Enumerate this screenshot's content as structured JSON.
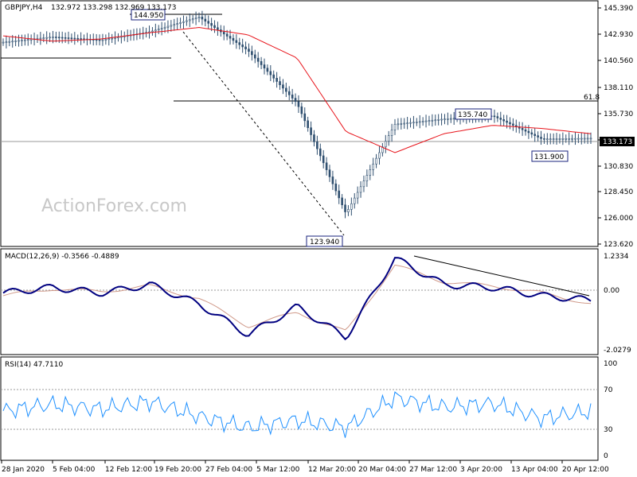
{
  "header": {
    "symbol": "GBPJPY,H4",
    "ohlc": "132.972 133.298 132.969 133.173"
  },
  "watermark": "ActionForex.com",
  "price_axis": {
    "ticks": [
      "145.390",
      "142.930",
      "140.560",
      "138.110",
      "135.730",
      "133.270",
      "130.830",
      "128.450",
      "126.000",
      "123.620"
    ],
    "current_label": "133.173"
  },
  "macd": {
    "label": "MACD(12,26,9) -0.3566 -0.4889",
    "ticks": [
      "1.2334",
      "0.00",
      "-2.0279"
    ]
  },
  "rsi": {
    "label": "RSI(14) 47.7110",
    "ticks": [
      "100",
      "70",
      "30",
      "0"
    ]
  },
  "time_axis": [
    "28 Jan 2020",
    "5 Feb 04:00",
    "12 Feb 12:00",
    "19 Feb 20:00",
    "27 Feb 04:00",
    "5 Mar 12:00",
    "12 Mar 20:00",
    "20 Mar 04:00",
    "27 Mar 12:00",
    "3 Apr 20:00",
    "13 Apr 04:00",
    "20 Apr 12:00"
  ],
  "annotations": {
    "high": "144.950",
    "low": "123.940",
    "recent_high": "135.740",
    "recent_low": "131.900",
    "fib_label": "61.8"
  },
  "colors": {
    "candles": "#2f4f6f",
    "moving_average": "#e8141b",
    "macd_line": "#000080",
    "signal_line": "#d09a8a",
    "rsi_line": "#1e90ff",
    "reference_lines": "#9a9a9a"
  },
  "chart_data": [
    {
      "type": "candlestick",
      "title": "GBPJPY,H4",
      "ylim": [
        123.6,
        145.4
      ],
      "x": [
        "28 Jan 2020",
        "5 Feb 04:00",
        "12 Feb 12:00",
        "19 Feb 20:00",
        "27 Feb 04:00",
        "5 Mar 12:00",
        "12 Mar 20:00",
        "20 Mar 04:00",
        "27 Mar 12:00",
        "3 Apr 20:00",
        "13 Apr 04:00",
        "20 Apr 12:00",
        "end"
      ],
      "series": [
        {
          "values": [
            142.3,
            142.8,
            142.5,
            143.3,
            144.7,
            141.5,
            136.5,
            126.0,
            134.5,
            135.0,
            135.3,
            133.1,
            133.17
          ]
        },
        {
          "name": "moving average",
          "values": [
            142.9,
            142.4,
            142.6,
            143.2,
            143.7,
            143.0,
            140.8,
            133.8,
            131.8,
            133.6,
            134.4,
            134.1,
            133.6
          ]
        }
      ],
      "levels": {
        "high": 144.95,
        "low": 123.94,
        "recent_high": 135.74,
        "recent_low": 131.9,
        "current": 133.173,
        "fib_61_8": 136.1
      }
    },
    {
      "type": "line",
      "title": "MACD(12,26,9) -0.3566 -0.4889",
      "ylim": [
        -2.0279,
        1.2334
      ],
      "x": [
        "28 Jan 2020",
        "5 Feb 04:00",
        "12 Feb 12:00",
        "19 Feb 20:00",
        "27 Feb 04:00",
        "5 Mar 12:00",
        "12 Mar 20:00",
        "20 Mar 04:00",
        "27 Mar 12:00",
        "3 Apr 20:00",
        "13 Apr 04:00",
        "20 Apr 12:00",
        "end"
      ],
      "series": [
        {
          "name": "MACD",
          "values": [
            -0.1,
            0.1,
            -0.1,
            0.2,
            -0.5,
            -1.6,
            -0.6,
            -1.7,
            1.15,
            0.2,
            0.1,
            -0.2,
            -0.36
          ]
        },
        {
          "name": "Signal",
          "values": [
            -0.2,
            0.05,
            -0.05,
            0.15,
            -0.3,
            -1.3,
            -0.8,
            -1.5,
            0.9,
            0.3,
            0.15,
            -0.1,
            -0.49
          ]
        }
      ]
    },
    {
      "type": "line",
      "title": "RSI(14) 47.7110",
      "ylim": [
        0,
        100
      ],
      "x": [
        "28 Jan 2020",
        "5 Feb 04:00",
        "12 Feb 12:00",
        "19 Feb 20:00",
        "27 Feb 04:00",
        "5 Mar 12:00",
        "12 Mar 20:00",
        "20 Mar 04:00",
        "27 Mar 12:00",
        "3 Apr 20:00",
        "13 Apr 04:00",
        "20 Apr 12:00",
        "end"
      ],
      "series": [
        {
          "name": "RSI",
          "values": [
            48,
            55,
            50,
            58,
            42,
            30,
            38,
            30,
            62,
            52,
            56,
            40,
            47.7
          ]
        }
      ],
      "reference_levels": [
        70,
        30
      ]
    }
  ]
}
